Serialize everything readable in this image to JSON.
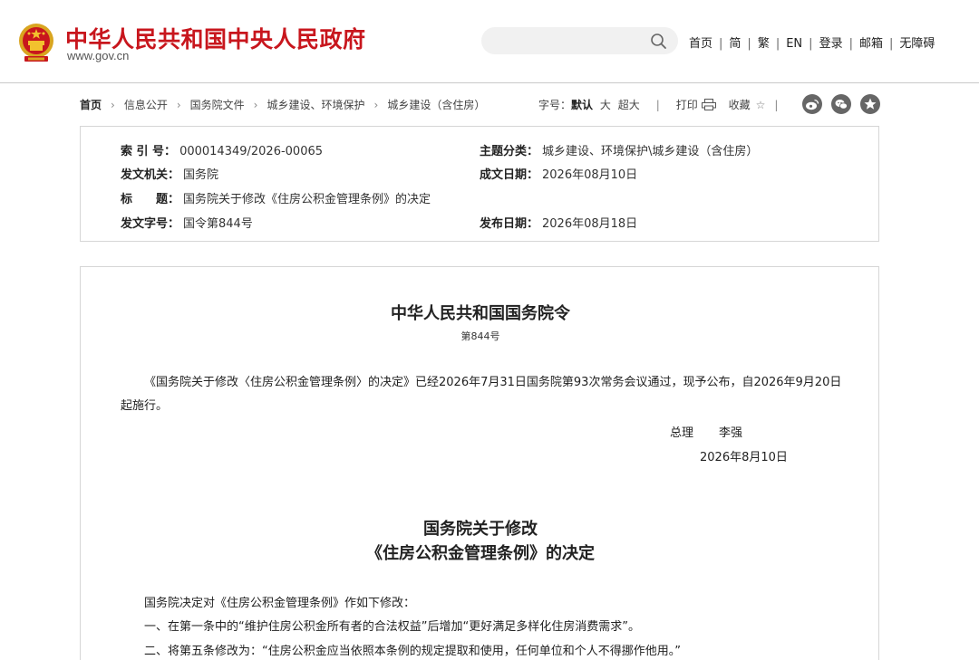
{
  "header": {
    "site_name": "中华人民共和国中央人民政府",
    "site_url": "www.gov.cn",
    "search_placeholder": "",
    "nav": [
      "首页",
      "简",
      "繁",
      "EN",
      "登录",
      "邮箱",
      "无障碍"
    ]
  },
  "breadcrumb": [
    "首页",
    "信息公开",
    "国务院文件",
    "城乡建设、环境保护",
    "城乡建设（含住房）"
  ],
  "tools": {
    "font_label": "字号：",
    "font_default": "默认",
    "font_large": "大",
    "font_xlarge": "超大",
    "print": "打印",
    "favorite": "收藏",
    "favorite_star": "☆",
    "share_icons": [
      "weibo-icon",
      "wechat-icon",
      "star-share-icon"
    ]
  },
  "info": {
    "index_label": "索 引 号：",
    "index_value": "000014349/2026-00065",
    "category_label": "主题分类：",
    "category_value": "城乡建设、环境保护\\城乡建设（含住房）",
    "issuer_label": "发文机关：",
    "issuer_value": "国务院",
    "date_label": "成文日期：",
    "date_value": "2026年08月10日",
    "title_label": "标　　题：",
    "title_value": "国务院关于修改《住房公积金管理条例》的决定",
    "doc_no_label": "发文字号：",
    "doc_no_value": "国令第844号",
    "publish_label": "发布日期：",
    "publish_value": "2026年08月18日"
  },
  "article": {
    "order_title": "中华人民共和国国务院令",
    "order_number": "第844号",
    "intro_line1": "《国务院关于修改〈住房公积金管理条例〉的决定》已经2026年7月31日国务院第93次常务会议通过，现予公布，自2026年9月20日",
    "intro_line2": "起施行。",
    "signer_role": "总理",
    "signer_name": "李强",
    "sign_date": "2026年8月10日",
    "decision_title_1": "国务院关于修改",
    "decision_title_2": "《住房公积金管理条例》的决定",
    "body": [
      "国务院决定对《住房公积金管理条例》作如下修改：",
      "一、在第一条中的“维护住房公积金所有者的合法权益”后增加“更好满足多样化住房消费需求”。",
      "二、将第五条修改为：“住房公积金应当依照本条例的规定提取和使用，任何单位和个人不得挪作他用。”"
    ]
  },
  "colors": {
    "brand_red": "#c8161d",
    "border": "#d6d6d6",
    "share_icon_bg": "#666666"
  }
}
